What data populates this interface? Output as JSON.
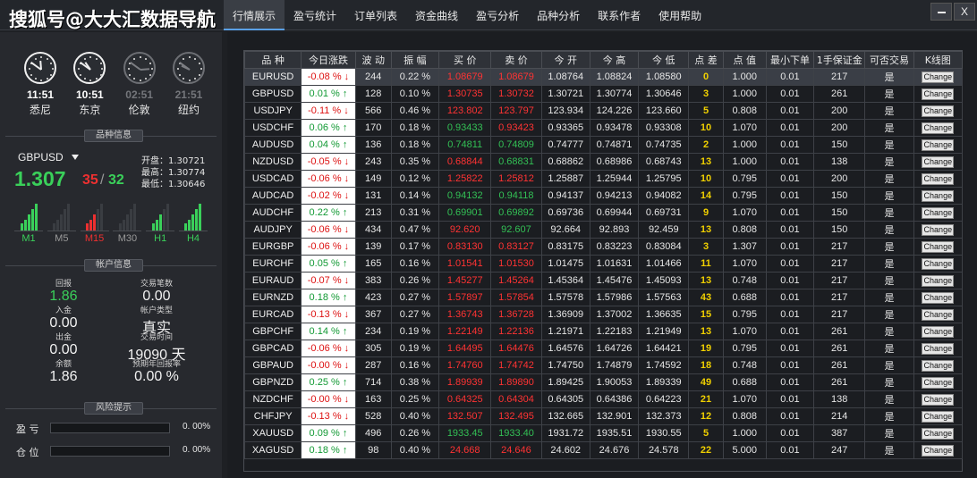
{
  "app": {
    "brand": "搜狐号@大大汇数据导航",
    "menu": [
      "行情展示",
      "盈亏统计",
      "订单列表",
      "资金曲线",
      "盈亏分析",
      "品种分析",
      "联系作者",
      "使用帮助"
    ],
    "active_menu": 0,
    "close_label": "X"
  },
  "clocks": [
    {
      "time": "11:51",
      "city": "悉尼",
      "active": true,
      "hour": 11,
      "minute": 51
    },
    {
      "time": "10:51",
      "city": "东京",
      "active": true,
      "hour": 10,
      "minute": 51
    },
    {
      "time": "02:51",
      "city": "伦敦",
      "active": false,
      "hour": 2,
      "minute": 51
    },
    {
      "time": "21:51",
      "city": "纽约",
      "active": false,
      "hour": 21,
      "minute": 51
    }
  ],
  "symbol_info": {
    "section_title": "品种信息",
    "symbol": "GBPUSD",
    "price_main": "1.307",
    "price_red": "35",
    "price_sep": "/",
    "price_green": "32",
    "open": "开盘：1.30721",
    "high": "最高：1.30774",
    "low": "最低：1.30646",
    "timeframes": [
      {
        "label": "M1",
        "color": "#3ad05a",
        "bars": [
          3,
          5,
          7,
          9,
          11
        ]
      },
      {
        "label": "M5",
        "color": "#888888",
        "bars": [
          0,
          0,
          0,
          0,
          0
        ]
      },
      {
        "label": "M15",
        "color": "#ee3030",
        "bars": [
          3,
          5,
          7,
          0,
          0
        ]
      },
      {
        "label": "M30",
        "color": "#888888",
        "bars": [
          0,
          0,
          0,
          0,
          0
        ]
      },
      {
        "label": "H1",
        "color": "#3ad05a",
        "bars": [
          3,
          5,
          7,
          0,
          0
        ]
      },
      {
        "label": "H4",
        "color": "#3ad05a",
        "bars": [
          3,
          5,
          7,
          9,
          11
        ]
      }
    ]
  },
  "account": {
    "section_title": "帐户信息",
    "cells": [
      {
        "label": "回报",
        "value": "1.86",
        "color": "#3ad05a"
      },
      {
        "label": "交易笔数",
        "value": "0.00",
        "color": "#f2f2f2"
      },
      {
        "label": "入金",
        "value": "0.00",
        "color": "#f2f2f2"
      },
      {
        "label": "帐户类型",
        "value": "真实",
        "color": "#f2f2f2"
      },
      {
        "label": "出金",
        "value": "0.00",
        "color": "#f2f2f2"
      },
      {
        "label": "交易时间",
        "value": "19090 天",
        "color": "#f2f2f2"
      },
      {
        "label": "余额",
        "value": "1.86",
        "color": "#f2f2f2"
      },
      {
        "label": "预期年回报率",
        "value": "0.00 %",
        "color": "#f2f2f2"
      }
    ]
  },
  "risk": {
    "section_title": "风险提示",
    "rows": [
      {
        "label": "盈 亏",
        "value": "0. 00%",
        "level": 0
      },
      {
        "label": "仓 位",
        "value": "0. 00%",
        "level": 0
      }
    ]
  },
  "table": {
    "headers": [
      "品 种",
      "今日涨跌",
      "波 动",
      "振 幅",
      "买 价",
      "卖 价",
      "今 开",
      "今 高",
      "今 低",
      "点 差",
      "点 值",
      "最小下单",
      "1手保证金",
      "可否交易",
      "K线图"
    ],
    "button_label": "Change",
    "rows": [
      {
        "sym": "EURUSD",
        "chg": "-0.08 % ↓",
        "dir": "down",
        "vol": "244",
        "amp": "0.22 %",
        "bid": "1.08679",
        "ask": "1.08679",
        "pc": "red",
        "open": "1.08764",
        "high": "1.08824",
        "low": "1.08580",
        "spread": "0",
        "pv": "1.000",
        "min": "0.01",
        "margin": "217",
        "trade": "是"
      },
      {
        "sym": "GBPUSD",
        "chg": "0.01 % ↑",
        "dir": "up",
        "vol": "128",
        "amp": "0.10 %",
        "bid": "1.30735",
        "ask": "1.30732",
        "pc": "red",
        "open": "1.30721",
        "high": "1.30774",
        "low": "1.30646",
        "spread": "3",
        "pv": "1.000",
        "min": "0.01",
        "margin": "261",
        "trade": "是"
      },
      {
        "sym": "USDJPY",
        "chg": "-0.11 % ↓",
        "dir": "down",
        "vol": "566",
        "amp": "0.46 %",
        "bid": "123.802",
        "ask": "123.797",
        "pc": "red",
        "open": "123.934",
        "high": "124.226",
        "low": "123.660",
        "spread": "5",
        "pv": "0.808",
        "min": "0.01",
        "margin": "200",
        "trade": "是"
      },
      {
        "sym": "USDCHF",
        "chg": "0.06 % ↑",
        "dir": "up",
        "vol": "170",
        "amp": "0.18 %",
        "bid": "0.93433",
        "ask": "0.93423",
        "pc": "mixed",
        "open": "0.93365",
        "high": "0.93478",
        "low": "0.93308",
        "spread": "10",
        "pv": "1.070",
        "min": "0.01",
        "margin": "200",
        "trade": "是"
      },
      {
        "sym": "AUDUSD",
        "chg": "0.04 % ↑",
        "dir": "up",
        "vol": "136",
        "amp": "0.18 %",
        "bid": "0.74811",
        "ask": "0.74809",
        "pc": "green",
        "open": "0.74777",
        "high": "0.74871",
        "low": "0.74735",
        "spread": "2",
        "pv": "1.000",
        "min": "0.01",
        "margin": "150",
        "trade": "是"
      },
      {
        "sym": "NZDUSD",
        "chg": "-0.05 % ↓",
        "dir": "down",
        "vol": "243",
        "amp": "0.35 %",
        "bid": "0.68844",
        "ask": "0.68831",
        "pc": "mixed2",
        "open": "0.68862",
        "high": "0.68986",
        "low": "0.68743",
        "spread": "13",
        "pv": "1.000",
        "min": "0.01",
        "margin": "138",
        "trade": "是"
      },
      {
        "sym": "USDCAD",
        "chg": "-0.06 % ↓",
        "dir": "down",
        "vol": "149",
        "amp": "0.12 %",
        "bid": "1.25822",
        "ask": "1.25812",
        "pc": "red",
        "open": "1.25887",
        "high": "1.25944",
        "low": "1.25795",
        "spread": "10",
        "pv": "0.795",
        "min": "0.01",
        "margin": "200",
        "trade": "是"
      },
      {
        "sym": "AUDCAD",
        "chg": "-0.02 % ↓",
        "dir": "down",
        "vol": "131",
        "amp": "0.14 %",
        "bid": "0.94132",
        "ask": "0.94118",
        "pc": "green",
        "open": "0.94137",
        "high": "0.94213",
        "low": "0.94082",
        "spread": "14",
        "pv": "0.795",
        "min": "0.01",
        "margin": "150",
        "trade": "是"
      },
      {
        "sym": "AUDCHF",
        "chg": "0.22 % ↑",
        "dir": "up",
        "vol": "213",
        "amp": "0.31 %",
        "bid": "0.69901",
        "ask": "0.69892",
        "pc": "green",
        "open": "0.69736",
        "high": "0.69944",
        "low": "0.69731",
        "spread": "9",
        "pv": "1.070",
        "min": "0.01",
        "margin": "150",
        "trade": "是"
      },
      {
        "sym": "AUDJPY",
        "chg": "-0.06 % ↓",
        "dir": "down",
        "vol": "434",
        "amp": "0.47 %",
        "bid": "92.620",
        "ask": "92.607",
        "pc": "mixed2",
        "open": "92.664",
        "high": "92.893",
        "low": "92.459",
        "spread": "13",
        "pv": "0.808",
        "min": "0.01",
        "margin": "150",
        "trade": "是"
      },
      {
        "sym": "EURGBP",
        "chg": "-0.06 % ↓",
        "dir": "down",
        "vol": "139",
        "amp": "0.17 %",
        "bid": "0.83130",
        "ask": "0.83127",
        "pc": "red",
        "open": "0.83175",
        "high": "0.83223",
        "low": "0.83084",
        "spread": "3",
        "pv": "1.307",
        "min": "0.01",
        "margin": "217",
        "trade": "是"
      },
      {
        "sym": "EURCHF",
        "chg": "0.05 % ↑",
        "dir": "up",
        "vol": "165",
        "amp": "0.16 %",
        "bid": "1.01541",
        "ask": "1.01530",
        "pc": "red",
        "open": "1.01475",
        "high": "1.01631",
        "low": "1.01466",
        "spread": "11",
        "pv": "1.070",
        "min": "0.01",
        "margin": "217",
        "trade": "是"
      },
      {
        "sym": "EURAUD",
        "chg": "-0.07 % ↓",
        "dir": "down",
        "vol": "383",
        "amp": "0.26 %",
        "bid": "1.45277",
        "ask": "1.45264",
        "pc": "red",
        "open": "1.45364",
        "high": "1.45476",
        "low": "1.45093",
        "spread": "13",
        "pv": "0.748",
        "min": "0.01",
        "margin": "217",
        "trade": "是"
      },
      {
        "sym": "EURNZD",
        "chg": "0.18 % ↑",
        "dir": "up",
        "vol": "423",
        "amp": "0.27 %",
        "bid": "1.57897",
        "ask": "1.57854",
        "pc": "red",
        "open": "1.57578",
        "high": "1.57986",
        "low": "1.57563",
        "spread": "43",
        "pv": "0.688",
        "min": "0.01",
        "margin": "217",
        "trade": "是"
      },
      {
        "sym": "EURCAD",
        "chg": "-0.13 % ↓",
        "dir": "down",
        "vol": "367",
        "amp": "0.27 %",
        "bid": "1.36743",
        "ask": "1.36728",
        "pc": "red",
        "open": "1.36909",
        "high": "1.37002",
        "low": "1.36635",
        "spread": "15",
        "pv": "0.795",
        "min": "0.01",
        "margin": "217",
        "trade": "是"
      },
      {
        "sym": "GBPCHF",
        "chg": "0.14 % ↑",
        "dir": "up",
        "vol": "234",
        "amp": "0.19 %",
        "bid": "1.22149",
        "ask": "1.22136",
        "pc": "red",
        "open": "1.21971",
        "high": "1.22183",
        "low": "1.21949",
        "spread": "13",
        "pv": "1.070",
        "min": "0.01",
        "margin": "261",
        "trade": "是"
      },
      {
        "sym": "GBPCAD",
        "chg": "-0.06 % ↓",
        "dir": "down",
        "vol": "305",
        "amp": "0.19 %",
        "bid": "1.64495",
        "ask": "1.64476",
        "pc": "red",
        "open": "1.64576",
        "high": "1.64726",
        "low": "1.64421",
        "spread": "19",
        "pv": "0.795",
        "min": "0.01",
        "margin": "261",
        "trade": "是"
      },
      {
        "sym": "GBPAUD",
        "chg": "-0.00 % ↓",
        "dir": "down",
        "vol": "287",
        "amp": "0.16 %",
        "bid": "1.74760",
        "ask": "1.74742",
        "pc": "red",
        "open": "1.74750",
        "high": "1.74879",
        "low": "1.74592",
        "spread": "18",
        "pv": "0.748",
        "min": "0.01",
        "margin": "261",
        "trade": "是"
      },
      {
        "sym": "GBPNZD",
        "chg": "0.25 % ↑",
        "dir": "up",
        "vol": "714",
        "amp": "0.38 %",
        "bid": "1.89939",
        "ask": "1.89890",
        "pc": "red",
        "open": "1.89425",
        "high": "1.90053",
        "low": "1.89339",
        "spread": "49",
        "pv": "0.688",
        "min": "0.01",
        "margin": "261",
        "trade": "是"
      },
      {
        "sym": "NZDCHF",
        "chg": "-0.00 % ↓",
        "dir": "down",
        "vol": "163",
        "amp": "0.25 %",
        "bid": "0.64325",
        "ask": "0.64304",
        "pc": "red",
        "open": "0.64305",
        "high": "0.64386",
        "low": "0.64223",
        "spread": "21",
        "pv": "1.070",
        "min": "0.01",
        "margin": "138",
        "trade": "是"
      },
      {
        "sym": "CHFJPY",
        "chg": "-0.13 % ↓",
        "dir": "down",
        "vol": "528",
        "amp": "0.40 %",
        "bid": "132.507",
        "ask": "132.495",
        "pc": "red",
        "open": "132.665",
        "high": "132.901",
        "low": "132.373",
        "spread": "12",
        "pv": "0.808",
        "min": "0.01",
        "margin": "214",
        "trade": "是"
      },
      {
        "sym": "XAUUSD",
        "chg": "0.09 % ↑",
        "dir": "up",
        "vol": "496",
        "amp": "0.26 %",
        "bid": "1933.45",
        "ask": "1933.40",
        "pc": "green",
        "open": "1931.72",
        "high": "1935.51",
        "low": "1930.55",
        "spread": "5",
        "pv": "1.000",
        "min": "0.01",
        "margin": "387",
        "trade": "是"
      },
      {
        "sym": "XAGUSD",
        "chg": "0.18 % ↑",
        "dir": "up",
        "vol": "98",
        "amp": "0.40 %",
        "bid": "24.668",
        "ask": "24.646",
        "pc": "red",
        "open": "24.602",
        "high": "24.676",
        "low": "24.578",
        "spread": "22",
        "pv": "5.000",
        "min": "0.01",
        "margin": "247",
        "trade": "是"
      }
    ]
  }
}
